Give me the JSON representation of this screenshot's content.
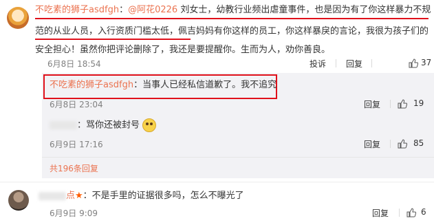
{
  "comment1": {
    "username": "不吃素的狮子asdfgh",
    "mention": "@阿花0226",
    "text_line1": "刘女士，幼教行业频出虐童事件，也是因为有了你这样暴力不规",
    "text_line2": "范的从业人员，入行资质门槛太低，佩吉妈妈有你这样的员工，你这样暴戾的言论，我很为孩子们的",
    "text_line3": "安全担心！虽然你把评论删除了，我还是要提醒你。生而为人，劝你善良。",
    "time": "6月8日 18:54",
    "report_label": "投诉",
    "reply_label": "回复",
    "like_count": "37"
  },
  "reply1": {
    "username": "不吃素的狮子asdfgh",
    "text": "：当事人已经私信道歉了。我不追究",
    "time": "6月8日 23:04",
    "reply_label": "回复",
    "like_count": "19"
  },
  "reply2": {
    "text": "：骂你还被封号",
    "time": "6月9日 17:16",
    "reply_label": "回复",
    "like_count": "85"
  },
  "replies_total": "共196条回复",
  "comment2": {
    "name_visible": "点",
    "text": "：不是手里的证据很多吗，怎么不曝光了",
    "time": "6月9日 9:09",
    "reply_label": "回复",
    "like_count": "6"
  },
  "colors": {
    "username": "#eb7350",
    "highlight": "#e0101a",
    "reply_bg": "#f2f2f5"
  }
}
